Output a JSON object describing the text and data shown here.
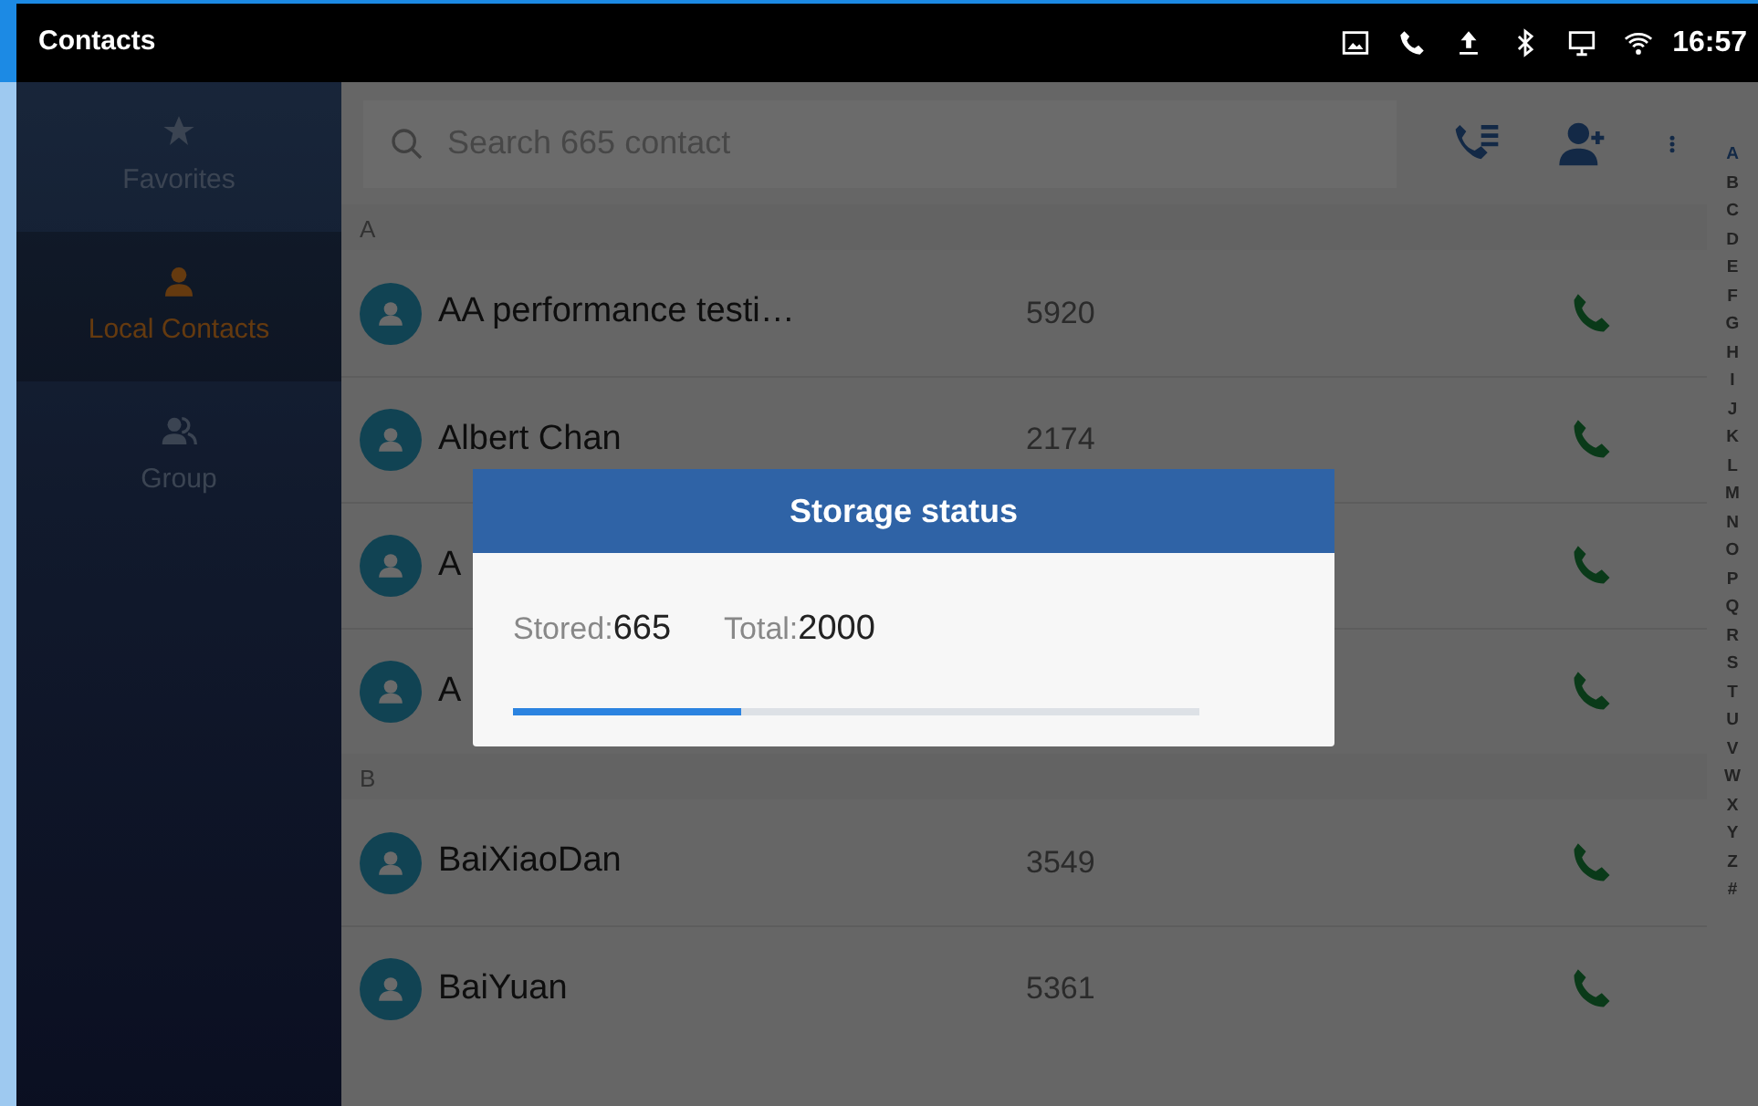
{
  "status_bar": {
    "app_title": "Contacts",
    "time": "16:57"
  },
  "sidebar": {
    "items": [
      {
        "label": "Favorites",
        "selected": false
      },
      {
        "label": "Local Contacts",
        "selected": true
      },
      {
        "label": "Group",
        "selected": false
      }
    ]
  },
  "search": {
    "placeholder": "Search 665 contact"
  },
  "sections": [
    {
      "letter": "A",
      "contacts": [
        {
          "name": "AA performance testi…",
          "number": "5920"
        },
        {
          "name": "Albert Chan",
          "number": "2174"
        },
        {
          "name": "A"
        },
        {
          "name": "A"
        }
      ]
    },
    {
      "letter": "B",
      "contacts": [
        {
          "name": "BaiXiaoDan",
          "number": "3549"
        },
        {
          "name": "BaiYuan",
          "number": "5361"
        }
      ]
    }
  ],
  "index_letters": [
    {
      "letter": "A",
      "selected": true
    },
    {
      "letter": "B",
      "selected": false
    },
    {
      "letter": "C",
      "selected": false
    },
    {
      "letter": "D",
      "selected": false
    },
    {
      "letter": "E",
      "selected": false
    },
    {
      "letter": "F",
      "selected": false
    },
    {
      "letter": "G",
      "selected": false
    },
    {
      "letter": "H",
      "selected": false
    },
    {
      "letter": "I",
      "selected": false
    },
    {
      "letter": "J",
      "selected": false
    },
    {
      "letter": "K",
      "selected": false
    },
    {
      "letter": "L",
      "selected": false
    },
    {
      "letter": "M",
      "selected": false
    },
    {
      "letter": "N",
      "selected": false
    },
    {
      "letter": "O",
      "selected": false
    },
    {
      "letter": "P",
      "selected": false
    },
    {
      "letter": "Q",
      "selected": false
    },
    {
      "letter": "R",
      "selected": false
    },
    {
      "letter": "S",
      "selected": false
    },
    {
      "letter": "T",
      "selected": false
    },
    {
      "letter": "U",
      "selected": false
    },
    {
      "letter": "V",
      "selected": false
    },
    {
      "letter": "W",
      "selected": false
    },
    {
      "letter": "X",
      "selected": false
    },
    {
      "letter": "Y",
      "selected": false
    },
    {
      "letter": "Z",
      "selected": false
    },
    {
      "letter": "#",
      "selected": false
    }
  ],
  "dialog": {
    "title": "Storage status",
    "stored_label": "Stored:",
    "stored_value": "665",
    "total_label": "Total:",
    "total_value": "2000",
    "level": 0.3325
  }
}
